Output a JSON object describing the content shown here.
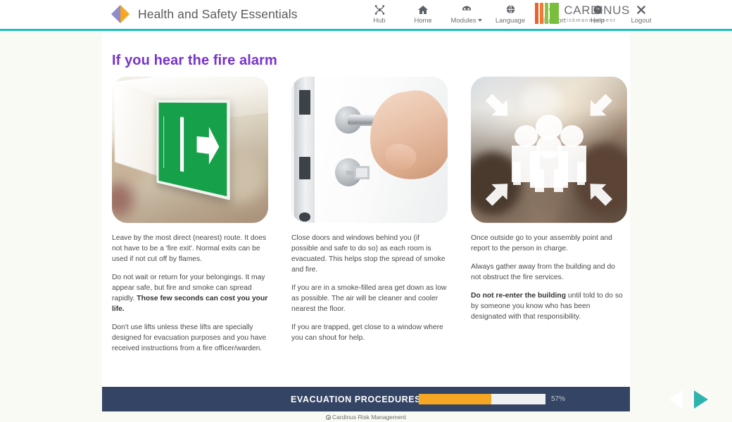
{
  "header": {
    "brand_title": "Health and Safety Essentials",
    "logo_icon": "diamond-logo",
    "nav": [
      {
        "label": "Hub",
        "icon": "hub-network-icon",
        "caret": false
      },
      {
        "label": "Home",
        "icon": "home-icon",
        "caret": false
      },
      {
        "label": "Modules",
        "icon": "modules-icon",
        "caret": true
      },
      {
        "label": "Language",
        "icon": "globe-icon",
        "caret": false
      },
      {
        "label": "Support",
        "icon": "speech-bubble-icon",
        "caret": false
      },
      {
        "label": "Help",
        "icon": "question-circle-icon",
        "caret": false
      },
      {
        "label": "Logout",
        "icon": "close-x-icon",
        "caret": false
      }
    ],
    "corporate_logo": {
      "name": "CARDINUS",
      "tagline": "riskmanagement",
      "bar_colors": [
        "#e8622e",
        "#f07b39",
        "#8cc63f",
        "#78bf3e"
      ]
    },
    "accent_color": "#1bbfc4"
  },
  "main": {
    "title": "If you hear the fire alarm",
    "title_color": "#7733cc",
    "columns": [
      {
        "image_name": "fire-exit-sign-photo",
        "image_alt": "Green emergency fire exit sign hanging from a ceiling",
        "paragraphs": [
          {
            "text": "Leave by the most direct (nearest) route. It does not have to be a 'fire exit'. Normal exits can be used if not cut off by flames.",
            "bold_tail": ""
          },
          {
            "text": "Do not wait or return for your belongings. It may appear safe, but fire and smoke can spread rapidly. ",
            "bold_tail": "Those few seconds can cost you your life."
          },
          {
            "text": "Don't use lifts unless these lifts are specially designed for evacuation purposes and you have received instructions from a fire officer/warden.",
            "bold_tail": ""
          }
        ]
      },
      {
        "image_name": "door-handle-photo",
        "image_alt": "Hand pressing down a metal door handle on a white door",
        "paragraphs": [
          {
            "text": "Close doors and windows behind you (if possible and safe to do so) as each room is evacuated. This helps stop the spread of smoke and fire.",
            "bold_tail": ""
          },
          {
            "text": "If you are in a smoke-filled area get down as low as possible. The air will be cleaner and cooler nearest the floor.",
            "bold_tail": ""
          },
          {
            "text": "If you are trapped, get close to a window where you can shout for help.",
            "bold_tail": ""
          }
        ]
      },
      {
        "image_name": "assembly-point-photo",
        "image_alt": "Assembly point icon of a group of people with arrows pointing inwards",
        "paragraphs": [
          {
            "text": "Once outside go to your assembly point and report to the person in charge.",
            "bold_tail": ""
          },
          {
            "text": "Always gather away from the building and do not obstruct the fire services.",
            "bold_tail": ""
          },
          {
            "bold_lead": "Do not re-enter the building",
            "text": " until told to do so by someone you know who has been designated with that responsibility.",
            "bold_tail": ""
          }
        ]
      }
    ]
  },
  "footer": {
    "module_name": "EVACUATION PROCEDURES",
    "progress_percent_label": "57%",
    "progress_percent_value": 57,
    "progress_fill_color": "#f5a623",
    "bar_color": "#344464",
    "prev_label": "previous",
    "next_label": "next",
    "next_color": "#2fb3ad"
  },
  "copyright": "Cardinus Risk Management"
}
